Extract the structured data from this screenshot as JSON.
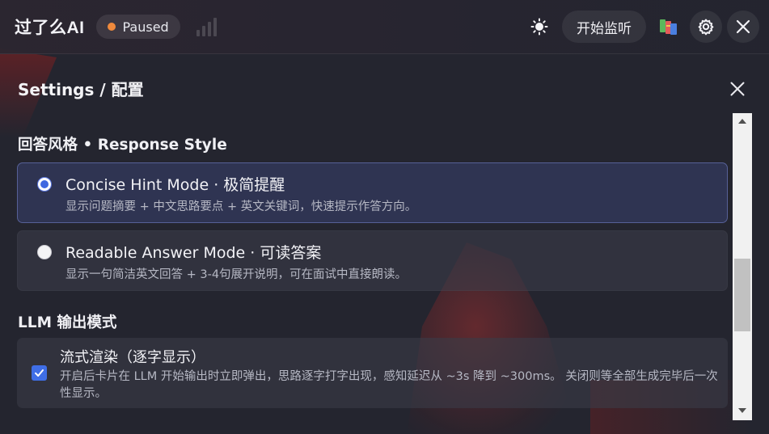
{
  "app": {
    "title": "过了么AI",
    "status_label": "Paused",
    "status_color": "#f08a3c"
  },
  "toolbar": {
    "theme_icon": "sun-icon",
    "listen_label": "开始监听",
    "books_icon": "books-icon",
    "settings_icon": "gear-icon",
    "close_icon": "close-icon"
  },
  "settings": {
    "title": "Settings / 配置",
    "response_style": {
      "heading": "回答风格 • Response Style",
      "options": [
        {
          "title": "Concise Hint Mode · 极简提醒",
          "desc": "显示问题摘要 + 中文思路要点 + 英文关键词，快速提示作答方向。",
          "selected": true
        },
        {
          "title": "Readable Answer Mode · 可读答案",
          "desc": "显示一句简洁英文回答 + 3-4句展开说明，可在面试中直接朗读。",
          "selected": false
        }
      ]
    },
    "llm_output": {
      "heading": "LLM 输出模式",
      "streaming": {
        "title": "流式渲染（逐字显示）",
        "desc": "开启后卡片在 LLM 开始输出时立即弹出，思路逐字打字出现，感知延迟从 ~3s 降到 ~300ms。 关闭则等全部生成完毕后一次性显示。",
        "checked": true
      }
    }
  },
  "colors": {
    "accent": "#3f67e0",
    "background": "#24252f"
  }
}
